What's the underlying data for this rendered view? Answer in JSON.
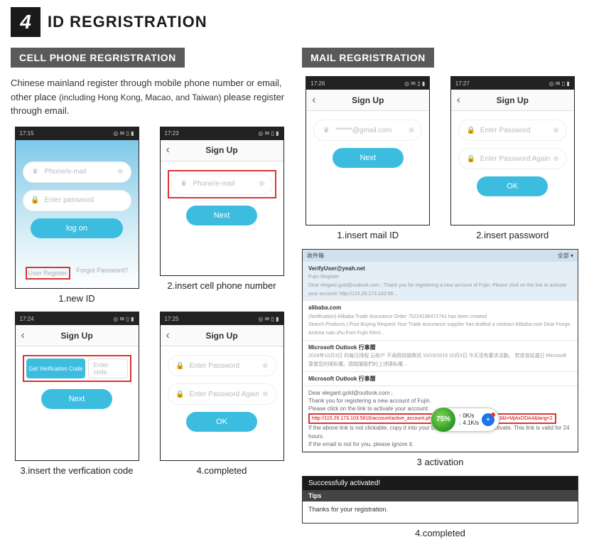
{
  "header": {
    "number": "4",
    "title": "ID REGRISTRATION"
  },
  "cell_section": {
    "banner": "CELL PHONE REGRISTRATION"
  },
  "mail_section": {
    "banner": "MAIL REGRISTRATION"
  },
  "intro": {
    "t1": "Chinese mainland  register through mobile phone number or email, other place ",
    "t2": "(including Hong Kong, Macao, and Taiwan) ",
    "t3": "please register through email."
  },
  "status": {
    "t1": "17:15",
    "t2": "17:23",
    "t3": "17:24",
    "t4": "17:25",
    "m1": "17:26",
    "m2": "17:27",
    "icons": "◎ ✉ ▯ ▮"
  },
  "labels": {
    "signup": "Sign Up",
    "phone_email": "Phone/e-mail",
    "enter_password": "Enter  password",
    "enter_password2": "Enter Password",
    "enter_password_again": "Enter Password Again",
    "logon": "log on",
    "next": "Next",
    "ok": "OK",
    "user_register": "User Register",
    "forgot": "Forgot Password?",
    "get_code": "Get Verification Code",
    "enter_code": "Enter code",
    "gmail": "******@gmail.com"
  },
  "captions": {
    "c1": "1.new ID",
    "c2": "2.insert cell phone number",
    "c3": "3.insert the verfication code",
    "c4": "4.completed",
    "m1": "1.insert mail ID",
    "m2": "2.insert password",
    "m3": "3 activation",
    "m4": "4.completed"
  },
  "email": {
    "inbox": "收件箱",
    "all": "全部 ▾",
    "from1": "VerifyUser@yeah.net",
    "sub1": "Fujin Register",
    "body1": "Dear elegant.gold@outlook.com ;   Thank you for registering a new account of Fujin. Please click on the link to activate your account: http://115.29.173.103:56...",
    "from2": "alibaba.com",
    "body2a": "(Notification) Alibaba Trade Assurance Order 75224198472741 has been created",
    "body2b": "Search Products | Post Buying Request     Your Trade Assurance supplier has drafted a contract  Alibaba.com  Dear Fungo Andrea     Ivan.zhu from Fujin Elect...",
    "from3": "Microsoft Outlook 行事曆",
    "body3": "2018年10月3日 的每日排程    云帐户 不適用詳細資訊  10/10/2019  10月3日  今天沒有要求活動。  若是曾延遲日 Microsoft 尊重您的隱私權。請閱讀我們的上述隱私權...",
    "from4": "Microsoft Outlook 行事曆",
    "detail_to": "Dear elegant.gold@outlook.com ;",
    "detail_l1": "Thank you for registering a new account of Fujin.",
    "detail_l2": "Please click on the link to activate your account:",
    "detail_link": "http://115.29.173.103:5616/account/active_account.php?key=dXNlcjE5MjkxMzc2MDI3&t=MjAxODA4&lang=2",
    "detail_l3": "If the above link is not clickable, copy it into your browser address bar to activate. This link is valid for 24 hours.",
    "detail_l4": "If the email is not for you, please ignore it."
  },
  "speed": {
    "pct": "75%",
    "up": "0K/s",
    "dn": "4.1K/s"
  },
  "success": {
    "top": "Successfully activated!",
    "tips": "Tips",
    "body": "Thanks for your registration."
  }
}
